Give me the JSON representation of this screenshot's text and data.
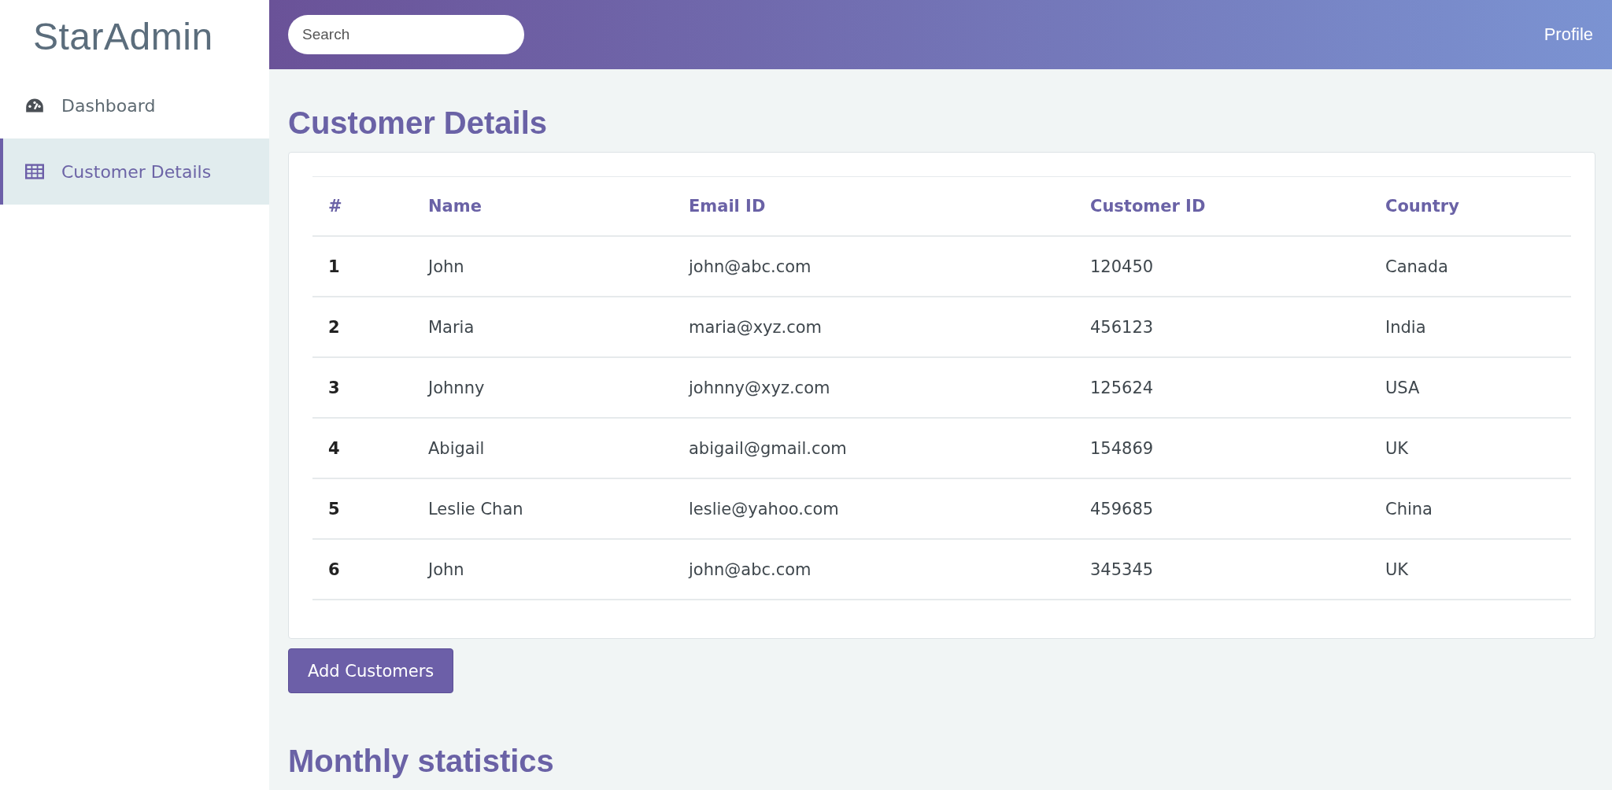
{
  "sidebar": {
    "logo": "StarAdmin",
    "items": [
      {
        "label": "Dashboard",
        "kind": "gauge",
        "selected": false
      },
      {
        "label": "Customer Details",
        "kind": "table",
        "selected": true
      }
    ]
  },
  "header": {
    "search": {
      "placeholder": "Search"
    },
    "profile": "Profile"
  },
  "title": "Customer Details",
  "table": {
    "columns": [
      "#",
      "Name",
      "Email ID",
      "Customer ID",
      "Country"
    ],
    "rows": [
      [
        "1",
        "John",
        "john@abc.com",
        "120450",
        "Canada"
      ],
      [
        "2",
        "Maria",
        "maria@xyz.com",
        "456123",
        "India"
      ],
      [
        "3",
        "Johnny",
        "johnny@xyz.com",
        "125624",
        "USA"
      ],
      [
        "4",
        "Abigail",
        "abigail@gmail.com",
        "154869",
        "UK"
      ],
      [
        "5",
        "Leslie Chan",
        "leslie@yahoo.com",
        "459685",
        "China"
      ],
      [
        "6",
        "John",
        "john@abc.com",
        "345345",
        "UK"
      ]
    ]
  },
  "add_button": "Add Customers",
  "section_title": "Monthly statistics"
}
